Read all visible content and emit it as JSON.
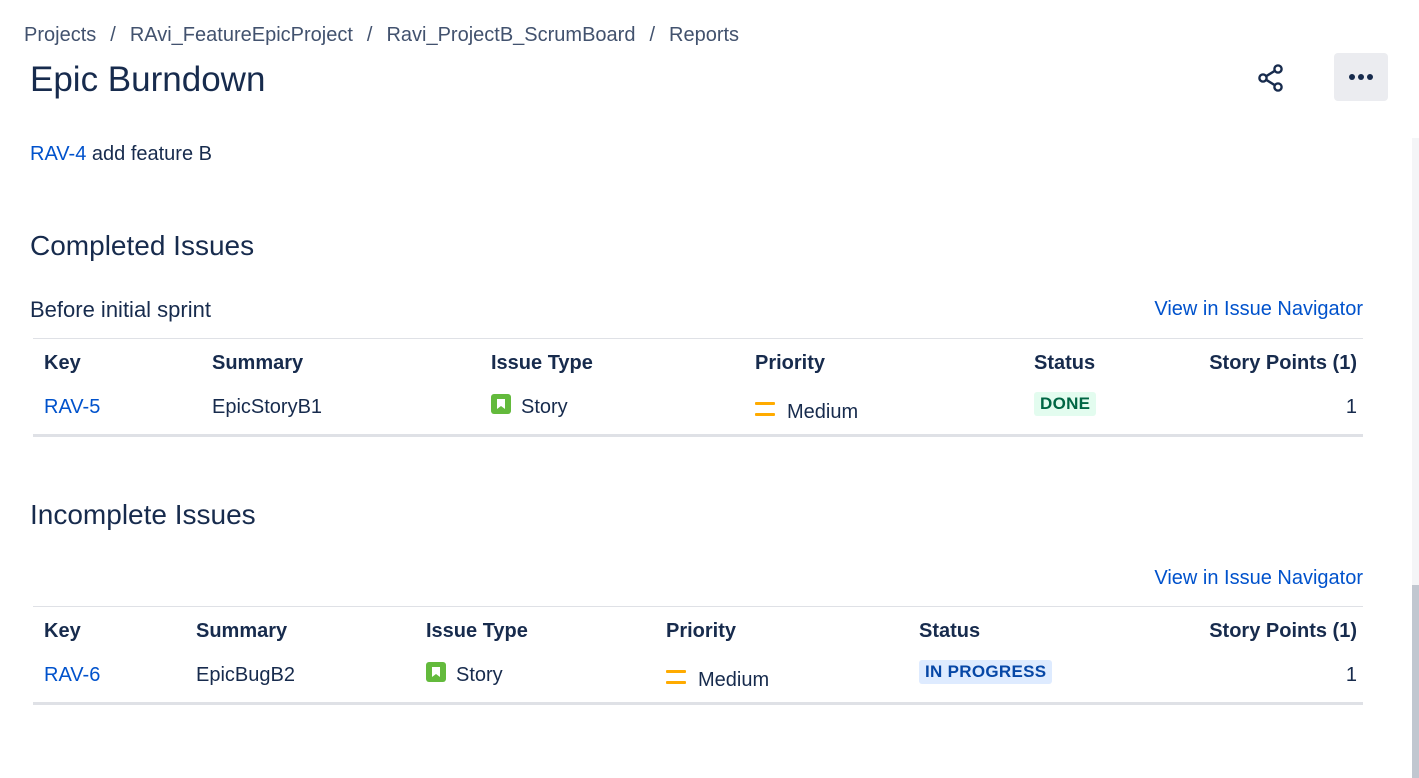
{
  "breadcrumb": {
    "items": [
      "Projects",
      "RAvi_FeatureEpicProject",
      "Ravi_ProjectB_ScrumBoard",
      "Reports"
    ],
    "separator": "/"
  },
  "page": {
    "title": "Epic Burndown",
    "share_icon": "share-icon",
    "more_icon": "more-horizontal-icon"
  },
  "epic": {
    "key": "RAV-4",
    "summary": "add feature B"
  },
  "completed": {
    "heading": "Completed Issues",
    "subheading": "Before initial sprint",
    "navigator_link": "View in Issue Navigator",
    "columns": [
      "Key",
      "Summary",
      "Issue Type",
      "Priority",
      "Status",
      "Story Points (1)"
    ],
    "rows": [
      {
        "key": "RAV-5",
        "summary": "EpicStoryB1",
        "type": "Story",
        "priority": "Medium",
        "status": "DONE",
        "points": "1"
      }
    ]
  },
  "incomplete": {
    "heading": "Incomplete Issues",
    "navigator_link": "View in Issue Navigator",
    "columns": [
      "Key",
      "Summary",
      "Issue Type",
      "Priority",
      "Status",
      "Story Points (1)"
    ],
    "rows": [
      {
        "key": "RAV-6",
        "summary": "EpicBugB2",
        "type": "Story",
        "priority": "Medium",
        "status": "IN PROGRESS",
        "points": "1"
      }
    ]
  },
  "colors": {
    "link": "#0052cc",
    "text": "#172b4d",
    "story_icon": "#63ba3c",
    "priority_medium": "#ffab00",
    "done_bg": "#e3fcef",
    "done_text": "#006644",
    "progress_bg": "#deebff",
    "progress_text": "#0747a6"
  }
}
